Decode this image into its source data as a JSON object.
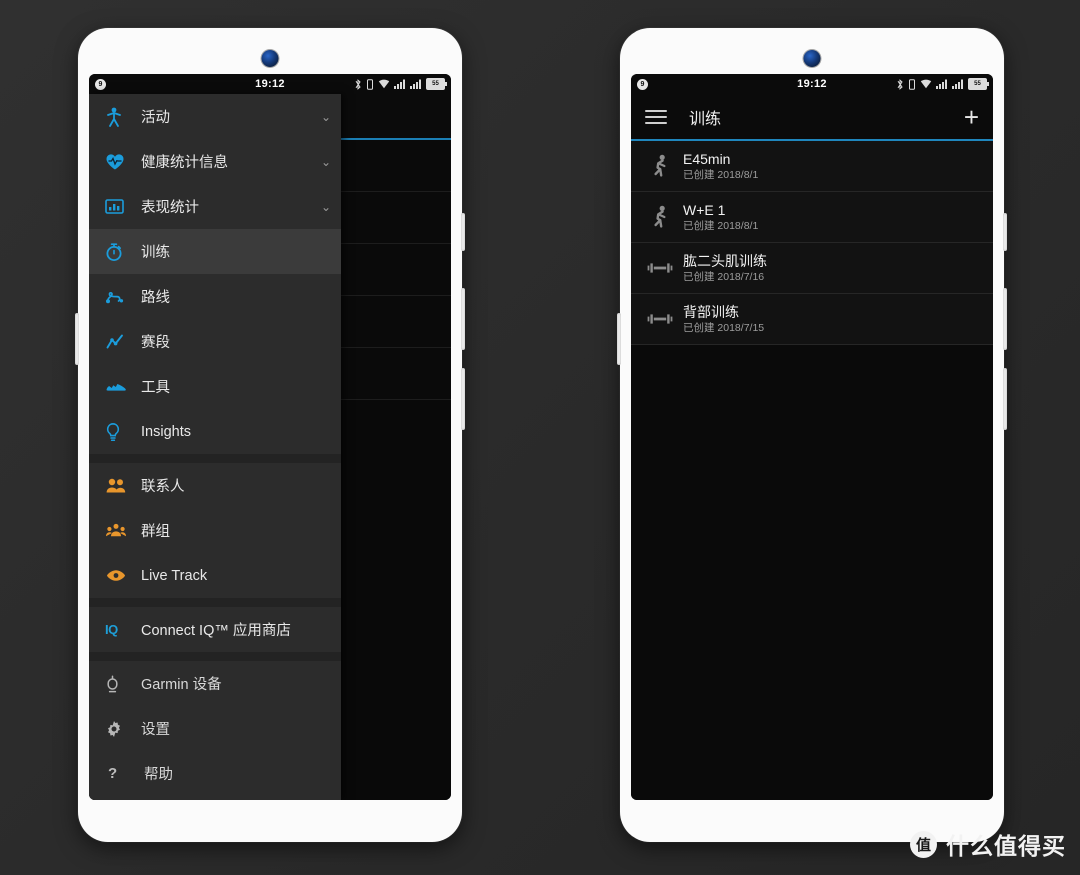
{
  "statusbar": {
    "time": "19:12",
    "left_badge": "9",
    "battery": "55",
    "icons": [
      "bluetooth-icon",
      "vibrate-icon",
      "wifi-icon",
      "signal-icon",
      "signal-icon",
      "battery-icon"
    ]
  },
  "drawer": {
    "groups": [
      {
        "items": [
          {
            "label": "活动",
            "icon": "activity-icon",
            "chevron": "⌄",
            "selected": false
          },
          {
            "label": "健康统计信息",
            "icon": "heart-icon",
            "chevron": "⌄",
            "selected": false
          },
          {
            "label": "表现统计",
            "icon": "chart-icon",
            "chevron": "⌄",
            "selected": false
          },
          {
            "label": "训练",
            "icon": "stopwatch-icon",
            "chevron": "",
            "selected": true
          },
          {
            "label": "路线",
            "icon": "route-icon",
            "chevron": "",
            "selected": false
          },
          {
            "label": "赛段",
            "icon": "segment-icon",
            "chevron": "",
            "selected": false
          },
          {
            "label": "工具",
            "icon": "shoe-icon",
            "chevron": "",
            "selected": false
          },
          {
            "label": "Insights",
            "icon": "bulb-icon",
            "chevron": "",
            "selected": false
          }
        ]
      },
      {
        "items": [
          {
            "label": "联系人",
            "icon": "contacts-icon",
            "chevron": "",
            "selected": false
          },
          {
            "label": "群组",
            "icon": "groups-icon",
            "chevron": "",
            "selected": false
          },
          {
            "label": "Live Track",
            "icon": "eye-icon",
            "chevron": "",
            "selected": false
          }
        ]
      },
      {
        "items": [
          {
            "label": "Connect IQ™ 应用商店",
            "icon": "iq-icon",
            "chevron": "",
            "selected": false
          }
        ]
      },
      {
        "items": [
          {
            "label": "Garmin 设备",
            "icon": "watch-icon",
            "chevron": "",
            "selected": false
          },
          {
            "label": "设置",
            "icon": "gear-icon",
            "chevron": "",
            "selected": false
          },
          {
            "label": "帮助",
            "icon": "question-icon",
            "chevron": "",
            "selected": false
          }
        ]
      }
    ]
  },
  "app": {
    "title": "训练",
    "menu_icon": "hamburger-icon",
    "add_icon": "plus-icon",
    "accent_color": "#1f86bd",
    "workouts": [
      {
        "name": "E45min",
        "created": "已创建 2018/8/1",
        "icon": "running-icon"
      },
      {
        "name": "W+E 1",
        "created": "已创建 2018/8/1",
        "icon": "running-icon"
      },
      {
        "name": "肱二头肌训练",
        "created": "已创建 2018/7/16",
        "icon": "dumbbell-icon"
      },
      {
        "name": "背部训练",
        "created": "已创建 2018/7/15",
        "icon": "dumbbell-icon"
      }
    ]
  },
  "watermark": {
    "badge": "值",
    "text": "什么值得买"
  }
}
